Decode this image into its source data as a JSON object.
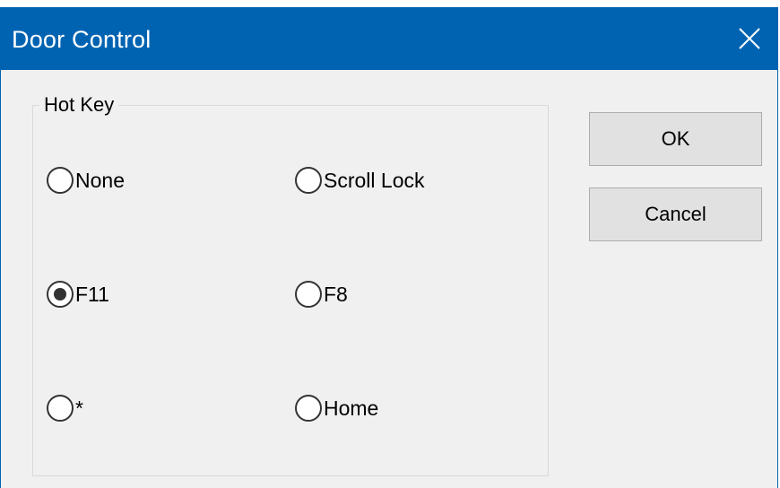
{
  "window": {
    "title": "Door Control",
    "close_icon": "close-icon",
    "accent_color": "#0063b1"
  },
  "hotkey_group": {
    "label": "Hot Key",
    "selected": "F11",
    "options": [
      {
        "label": "None",
        "checked": false
      },
      {
        "label": "Scroll Lock",
        "checked": false
      },
      {
        "label": "F11",
        "checked": true
      },
      {
        "label": "F8",
        "checked": false
      },
      {
        "label": "*",
        "checked": false
      },
      {
        "label": "Home",
        "checked": false
      }
    ]
  },
  "buttons": {
    "ok_label": "OK",
    "cancel_label": "Cancel"
  }
}
